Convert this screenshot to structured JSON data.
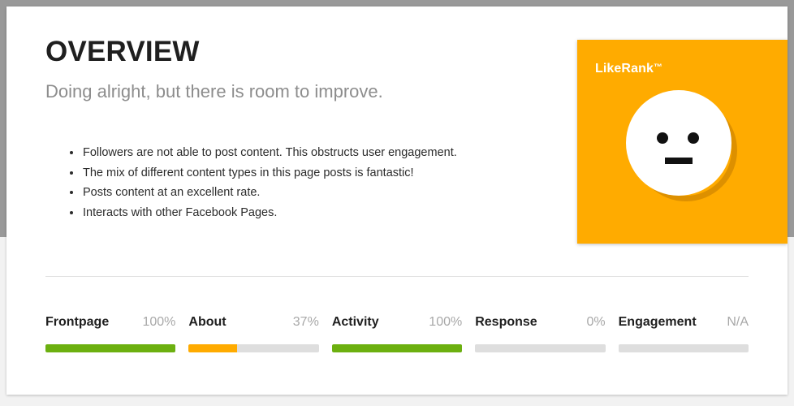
{
  "header": {
    "title": "OVERVIEW",
    "subtitle": "Doing alright, but there is room to improve."
  },
  "findings": [
    {
      "text": "Followers are not able to post content. This obstructs user engagement."
    },
    {
      "text": "The mix of different content types in this page posts is fantastic!"
    },
    {
      "text": "Posts content at an excellent rate."
    },
    {
      "text": "Interacts with other Facebook Pages."
    }
  ],
  "likerank": {
    "title": "LikeRank",
    "trademark": "™",
    "face_icon": "neutral-face-icon",
    "background_color": "#ffab00",
    "ring_color": "#dd9000",
    "face_color": "#ffffff",
    "feature_color": "#111111"
  },
  "metrics": [
    {
      "label": "Frontpage",
      "value": "100%",
      "percent": 100,
      "color": "#6cb010"
    },
    {
      "label": "About",
      "value": "37%",
      "percent": 37,
      "color": "#ffab00"
    },
    {
      "label": "Activity",
      "value": "100%",
      "percent": 100,
      "color": "#6cb010"
    },
    {
      "label": "Response",
      "value": "0%",
      "percent": 0,
      "color": "#dedede"
    },
    {
      "label": "Engagement",
      "value": "N/A",
      "percent": 0,
      "color": "#dedede"
    }
  ],
  "colors": {
    "page_background": "#f2f2f2",
    "backdrop_gray": "#999999",
    "card_background": "#ffffff",
    "green": "#6cb010",
    "orange": "#ffab00",
    "track_gray": "#dedede",
    "muted_text": "#a8a8a8"
  }
}
